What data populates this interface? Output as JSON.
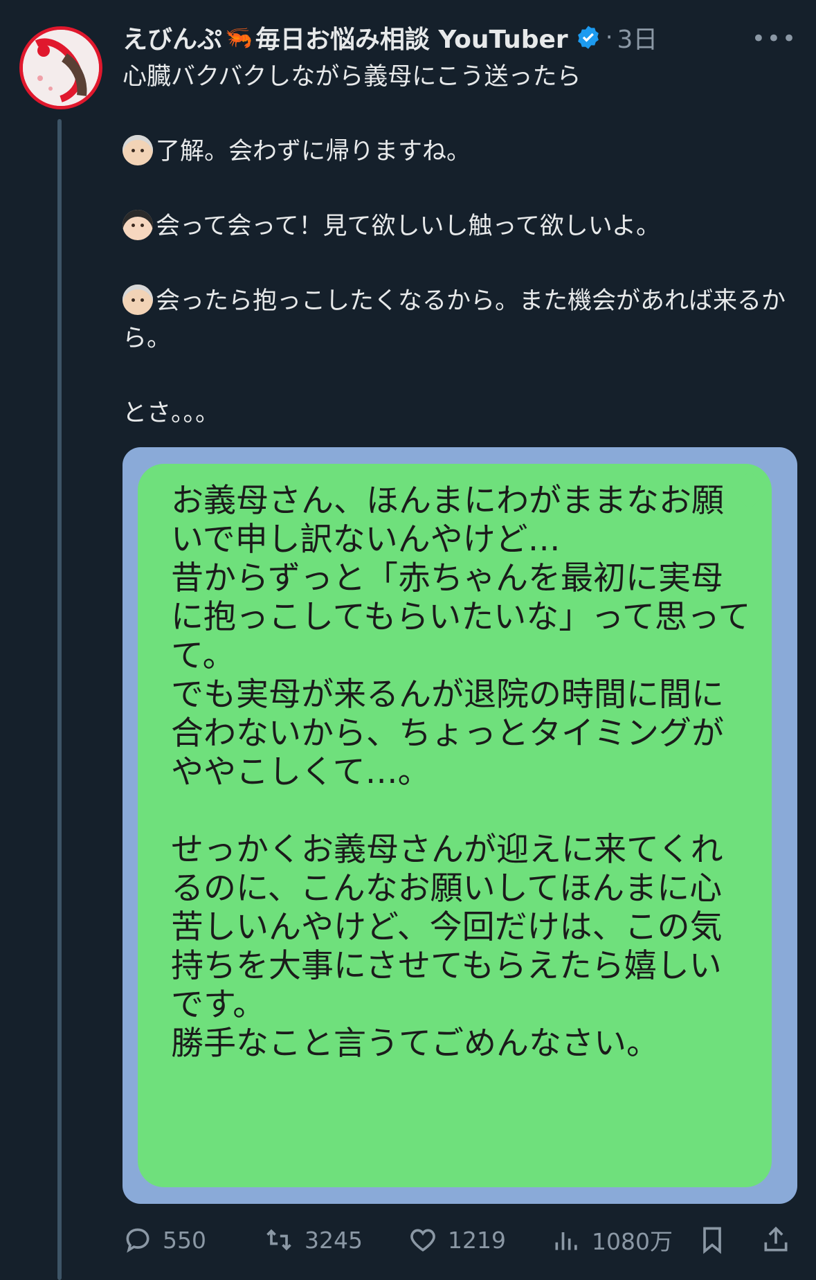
{
  "post": {
    "author_name": "えびんぷ",
    "author_emoji": "🦐",
    "author_title": "毎日お悩み相談 YouTuber",
    "time": "3日",
    "more_label": "•••",
    "lines": {
      "l1": "心臓バクバクしながら義母にこう送ったら",
      "l2": "了解。会わずに帰りますね。",
      "l3": "会って会って！見て欲しいし触って欲しいよ。",
      "l4": "会ったら抱っこしたくなるから。また機会があれば来るから。",
      "l5": "とさ。。。"
    }
  },
  "message": {
    "p1": "お義母さん、ほんまにわがままなお願いで申し訳ないんやけど…\n昔からずっと「赤ちゃんを最初に実母に抱っこしてもらいたいな」って思ってて。\nでも実母が来るんが退院の時間に間に合わないから、ちょっとタイミングがややこしくて…。",
    "p2": "せっかくお義母さんが迎えに来てくれるのに、こんなお願いしてほんまに心苦しいんやけど、今回だけは、この気持ちを大事にさせてもらえたら嬉しいです。\n勝手なこと言うてごめんなさい。"
  },
  "actions": {
    "replies": "550",
    "reposts": "3245",
    "likes": "1219",
    "views": "1080万"
  },
  "icons": [
    "reply-icon",
    "repost-icon",
    "like-icon",
    "views-icon",
    "bookmark-icon",
    "share-icon",
    "verified-badge-icon"
  ],
  "colors": {
    "background": "#15202b",
    "verified": "#1d9bf0",
    "bubble": "#6fe07c",
    "image_bg": "#8aaad8",
    "muted": "#8b98a5"
  }
}
